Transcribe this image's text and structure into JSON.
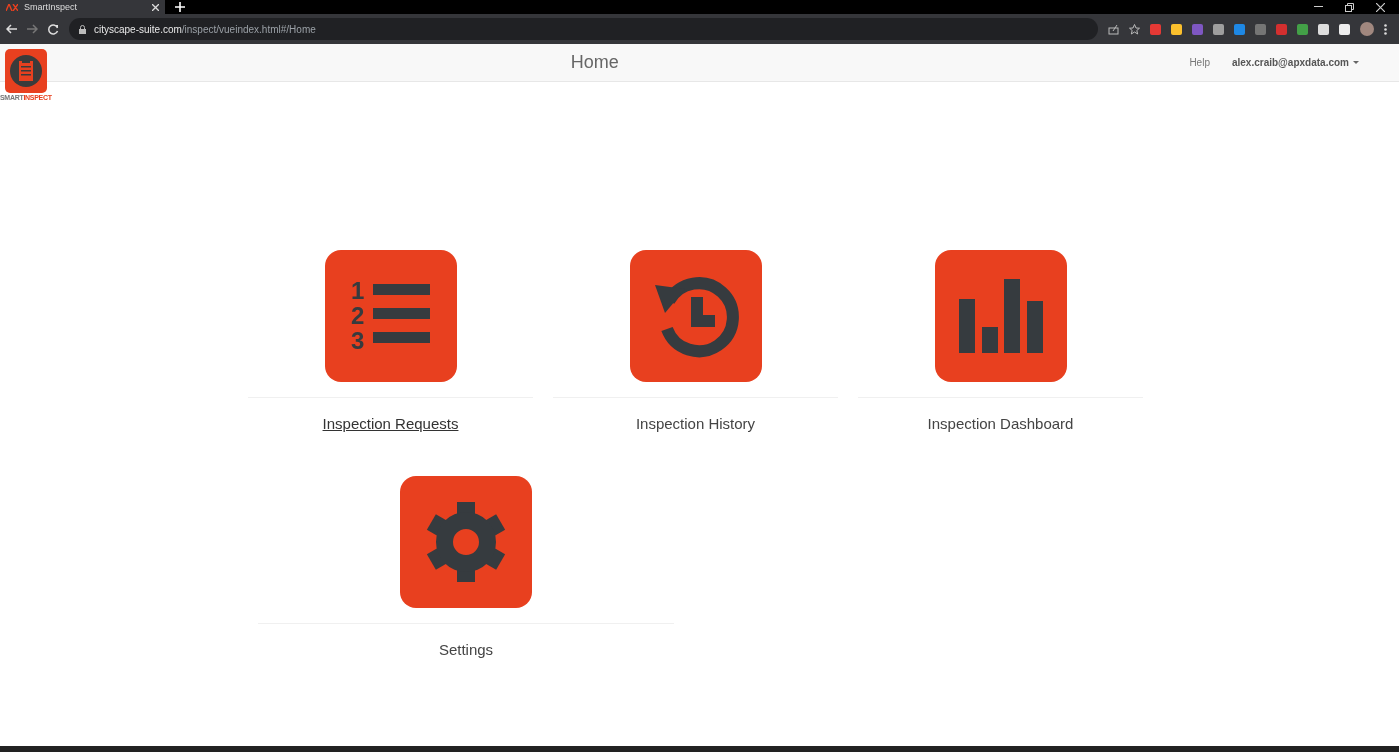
{
  "browser": {
    "tab": {
      "title": "SmartInspect",
      "selected": true
    },
    "url_host": "cityscape-suite.com",
    "url_path": "/inspect/vueindex.html#/Home"
  },
  "app": {
    "logo_text_a": "SMART",
    "logo_text_b": "INSPECT",
    "title": "Home",
    "help": "Help",
    "user": "alex.craib@apxdata.com"
  },
  "rows": [
    {
      "tiles": [
        {
          "kind": "list",
          "label": "Inspection Requests",
          "hovered": true,
          "numbers": [
            "1",
            "2",
            "3"
          ]
        },
        {
          "kind": "history",
          "label": "Inspection History",
          "hovered": false
        },
        {
          "kind": "chart",
          "label": "Inspection Dashboard",
          "hovered": false
        }
      ]
    },
    {
      "tiles": [
        {
          "kind": "settings",
          "label": "Settings",
          "hovered": false
        }
      ]
    }
  ]
}
